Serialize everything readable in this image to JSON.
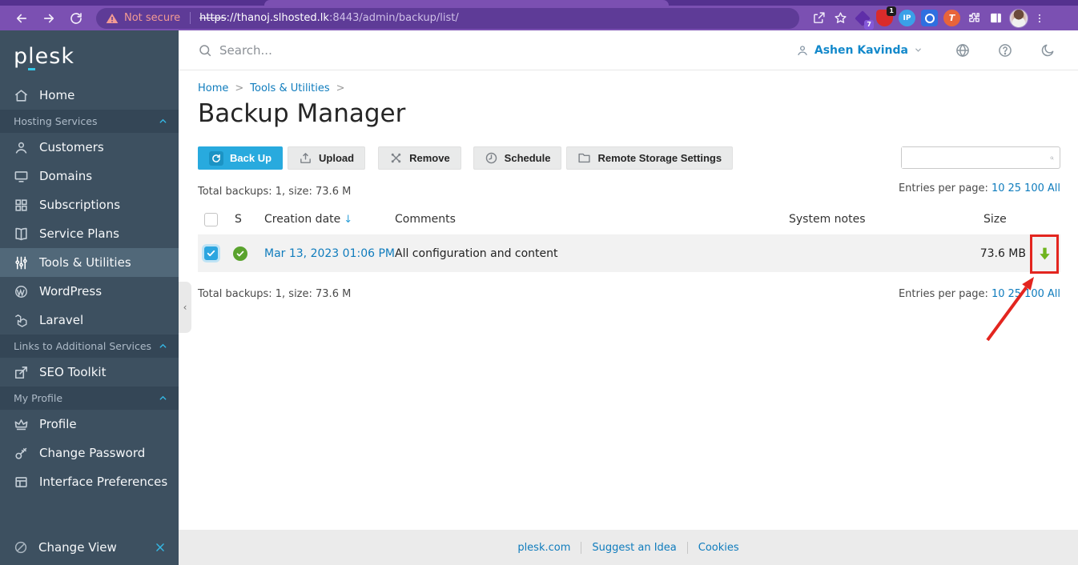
{
  "colors": {
    "accent_blue": "#28aade",
    "link_blue": "#0f7cbd",
    "sidebar_bg": "#3d5060",
    "browser_purple": "#7b50b2",
    "annotation_red": "#e3251f",
    "download_green": "#6fb41e",
    "status_green": "#5aa32e"
  },
  "browser": {
    "not_secure_label": "Not secure",
    "url_scheme": "https",
    "url_host": "://thanoj.slhosted.lk",
    "url_path": ":8443/admin/backup/list/",
    "ext_badge_purple": "7",
    "ext_badge_red": "1",
    "ext_ip_label": "IP",
    "ext_o_label": "O",
    "ext_t_label": "T"
  },
  "topbar": {
    "search_placeholder": "Search...",
    "user_name": "Ashen Kavinda"
  },
  "sidebar": {
    "logo_pre": "p",
    "logo_underlined": "l",
    "logo_post": "esk",
    "items": [
      {
        "label": "Home",
        "type": "item"
      },
      {
        "label": "Hosting Services",
        "type": "section"
      },
      {
        "label": "Customers",
        "type": "item"
      },
      {
        "label": "Domains",
        "type": "item"
      },
      {
        "label": "Subscriptions",
        "type": "item"
      },
      {
        "label": "Service Plans",
        "type": "item"
      },
      {
        "label": "Tools & Utilities",
        "type": "item",
        "active": true
      },
      {
        "label": "WordPress",
        "type": "item"
      },
      {
        "label": "Laravel",
        "type": "item"
      },
      {
        "label": "Links to Additional Services",
        "type": "section"
      },
      {
        "label": "SEO Toolkit",
        "type": "item"
      },
      {
        "label": "My Profile",
        "type": "section"
      },
      {
        "label": "Profile",
        "type": "item"
      },
      {
        "label": "Change Password",
        "type": "item"
      },
      {
        "label": "Interface Preferences",
        "type": "item"
      }
    ],
    "change_view_label": "Change View"
  },
  "main": {
    "breadcrumb": {
      "home": "Home",
      "tools_utilities": "Tools & Utilities"
    },
    "title": "Backup Manager",
    "toolbar": {
      "back_up": "Back Up",
      "upload": "Upload",
      "remove": "Remove",
      "schedule": "Schedule",
      "remote_storage": "Remote Storage Settings"
    },
    "total_text": "Total backups: 1, size: 73.6 M",
    "entries": {
      "label": "Entries per page:",
      "options": [
        "10",
        "25",
        "100",
        "All"
      ]
    },
    "table": {
      "headers": {
        "status": "S",
        "creation_date": "Creation date",
        "sort_arrow": "↓",
        "comments": "Comments",
        "system_notes": "System notes",
        "size": "Size"
      },
      "row": {
        "creation_date": "Mar 13, 2023 01:06 PM",
        "comment": "All configuration and content",
        "size": "73.6 MB"
      }
    }
  },
  "footer": {
    "links": [
      "plesk.com",
      "Suggest an Idea",
      "Cookies"
    ]
  }
}
